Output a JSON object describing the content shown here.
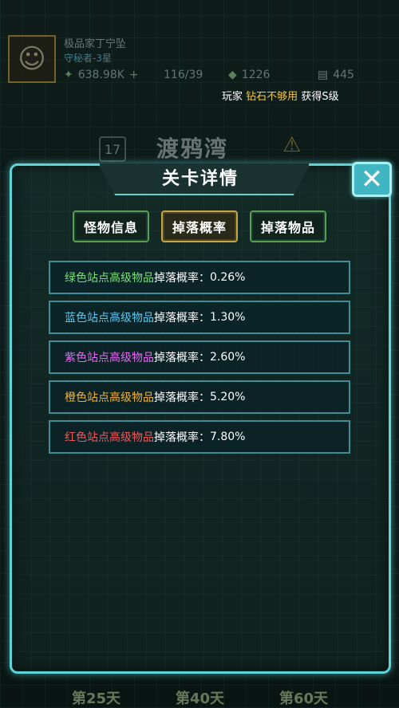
{
  "topbar": {
    "player_name": "极品家丁宁坠",
    "player_rank": "守秘者-3星",
    "gold": "638.98K",
    "energy": "116/39",
    "diamonds": "1226",
    "cash": "445"
  },
  "notice": {
    "prefix": "玩家",
    "highlight": "钻石不够用",
    "suffix": "获得S级"
  },
  "stage": {
    "number": "17",
    "title": "渡鸦湾"
  },
  "modal": {
    "title": "关卡详情",
    "close_icon_glyph": "✕",
    "tabs": [
      {
        "label": "怪物信息",
        "active": false
      },
      {
        "label": "掉落概率",
        "active": true
      },
      {
        "label": "掉落物品",
        "active": false
      }
    ],
    "drop_rows": [
      {
        "name": "绿色站点高级物品",
        "mid": "掉落概率：",
        "value": "0.26%",
        "color": "#7be07b"
      },
      {
        "name": "蓝色站点高级物品",
        "mid": "掉落概率：",
        "value": "1.30%",
        "color": "#5cc8f0"
      },
      {
        "name": "紫色站点高级物品",
        "mid": "掉落概率：",
        "value": "2.60%",
        "color": "#e66bf0"
      },
      {
        "name": "橙色站点高级物品",
        "mid": "掉落概率：",
        "value": "5.20%",
        "color": "#f2b233"
      },
      {
        "name": "红色站点高级物品",
        "mid": "掉落概率：",
        "value": "7.80%",
        "color": "#f05858"
      }
    ]
  },
  "bottom": {
    "days": [
      "第25天",
      "第40天",
      "第60天"
    ]
  },
  "colors": {
    "accent": "#5fd3d6",
    "tab_border": "#5a9e55",
    "tab_active_border": "#c7a54a"
  }
}
